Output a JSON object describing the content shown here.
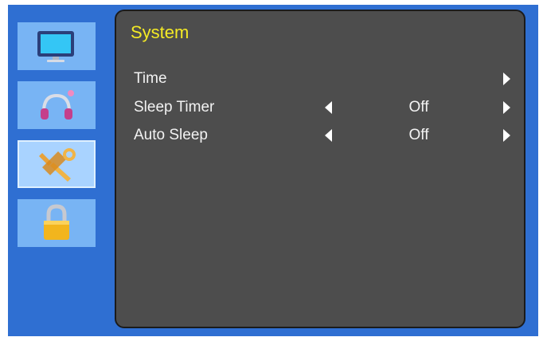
{
  "sidebar": {
    "items": [
      {
        "name": "picture",
        "icon": "monitor-icon"
      },
      {
        "name": "sound",
        "icon": "headphones-icon"
      },
      {
        "name": "system",
        "icon": "wrench-icon",
        "active": true
      },
      {
        "name": "lock",
        "icon": "padlock-icon"
      }
    ]
  },
  "panel": {
    "title": "System",
    "rows": [
      {
        "label": "Time",
        "value": null
      },
      {
        "label": "Sleep Timer",
        "value": "Off"
      },
      {
        "label": "Auto Sleep",
        "value": "Off"
      }
    ]
  },
  "colors": {
    "frame": "#2f6fd2",
    "panel": "#4d4d4d",
    "title": "#f4ea25",
    "text": "#f2f2f2"
  }
}
